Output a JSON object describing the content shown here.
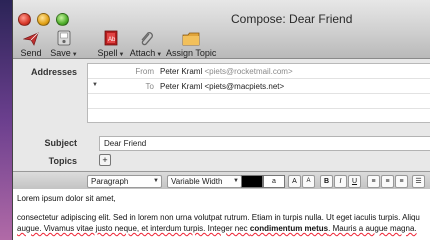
{
  "window": {
    "title": "Compose: Dear Friend"
  },
  "toolbar": {
    "send": "Send",
    "save": "Save",
    "spell": "Spell",
    "attach": "Attach",
    "assign_topic": "Assign Topic"
  },
  "headers": {
    "addresses_label": "Addresses",
    "from_label": "From",
    "from_value": "Peter Kraml",
    "from_email": "<piets@rocketmail.com>",
    "to_label": "To",
    "to_value": "Peter Kraml <piets@macpiets.net>",
    "subject_label": "Subject",
    "subject_value": "Dear Friend",
    "topics_label": "Topics"
  },
  "format": {
    "paragraph": "Paragraph",
    "width": "Variable Width",
    "color_a": "a",
    "bigger": "A",
    "smaller": "A",
    "bold": "B",
    "italic": "I",
    "underline": "U"
  },
  "body": {
    "line1": "Lorem ipsum dolor sit amet,",
    "line2": "consectetur adipiscing elit. Sed in lorem non urna volutpat rutrum. Etiam in turpis nulla. Ut eget iaculis turpis. Aliqu",
    "line3a": "augue. Vivamus vitae justo neque, et interdum turpis. Integer nec ",
    "line3b": "condimentum metus",
    "line3c": ". Mauris a augue magna."
  }
}
